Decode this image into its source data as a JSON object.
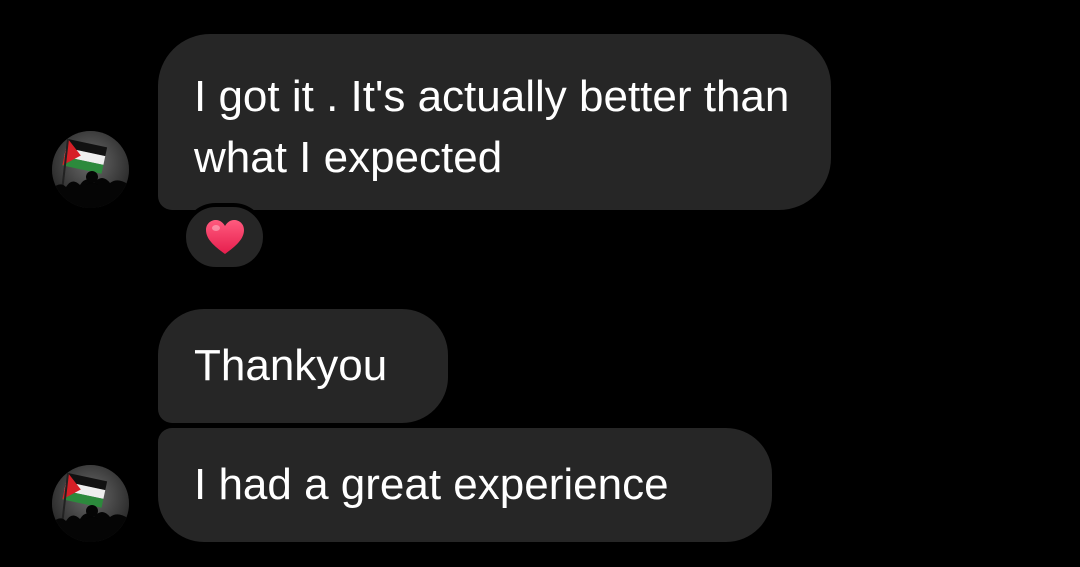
{
  "messages": [
    {
      "text": "I got it . It's actually better than what I expected",
      "reaction": "heart-emoji"
    },
    {
      "text": "Thankyou"
    },
    {
      "text": "I had a great experience"
    }
  ],
  "colors": {
    "background": "#000000",
    "bubble": "#262626",
    "text": "#ffffff",
    "heart": "#f02d59"
  }
}
